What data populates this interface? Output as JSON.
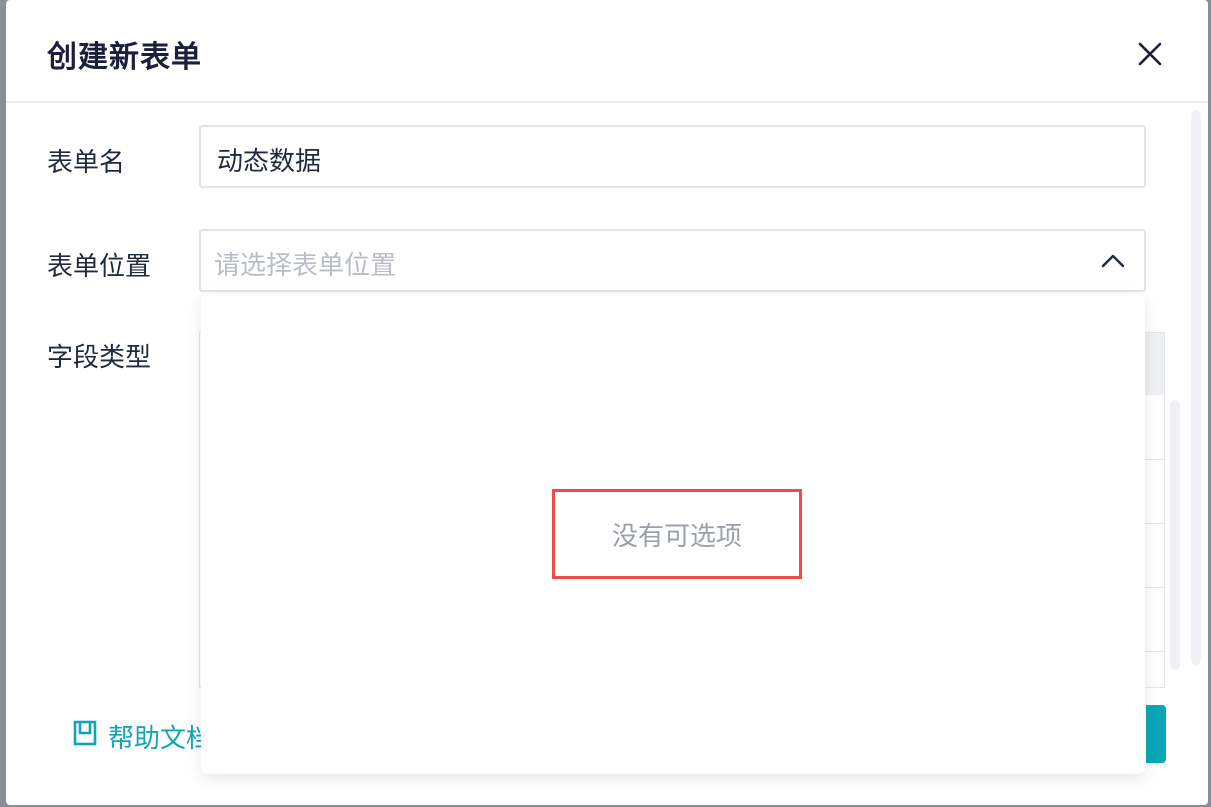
{
  "modal": {
    "title": "创建新表单",
    "close_icon": "close-icon"
  },
  "form": {
    "name_label": "表单名",
    "name_value": "动态数据",
    "location_label": "表单位置",
    "location_placeholder": "请选择表单位置",
    "field_type_label": "字段类型"
  },
  "dropdown": {
    "empty_text": "没有可选项"
  },
  "footer": {
    "help_label": "帮助文档",
    "help_icon": "book-icon"
  },
  "colors": {
    "accent": "#0ea5b8",
    "highlight_border": "#ee4b4b",
    "title": "#1b1f3b"
  }
}
